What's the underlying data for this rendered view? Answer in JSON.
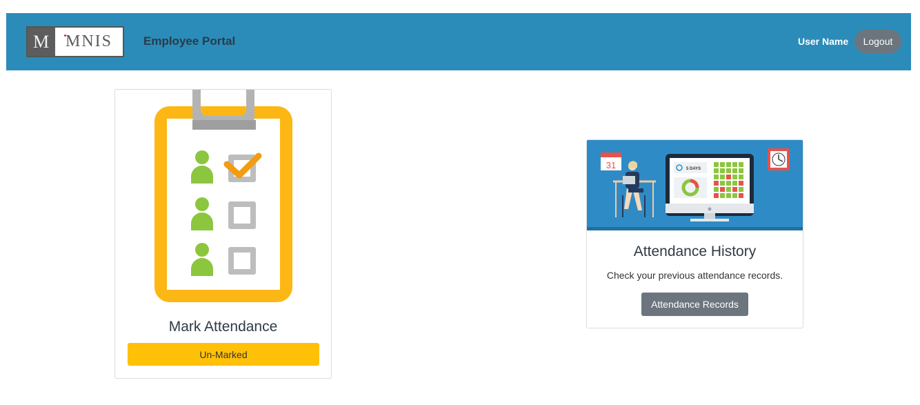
{
  "header": {
    "logo_left": "M",
    "logo_right": "MNIS",
    "brand": "Employee Portal",
    "user_name": "User Name",
    "logout_label": "Logout"
  },
  "mark_card": {
    "title": "Mark Attendance",
    "status_label": "Un-Marked"
  },
  "history_card": {
    "title": "Attendance History",
    "text": "Check your previous attendance records.",
    "button_label": "Attendance Records",
    "calendar_day": "31",
    "days_label": "5 DAYS"
  },
  "colors": {
    "navbar": "#2b8cb9",
    "status_yellow": "#ffc107",
    "button_gray": "#6c757d",
    "clipboard_orange": "#fdb714",
    "person_green": "#8cc63f"
  }
}
